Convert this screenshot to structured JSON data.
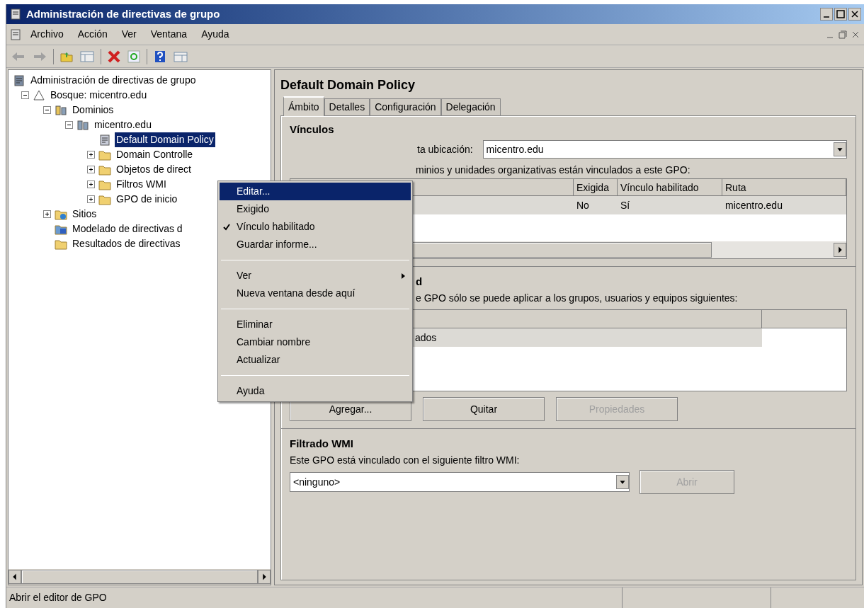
{
  "window": {
    "title": "Administración de directivas de grupo"
  },
  "menu_bar": [
    "Archivo",
    "Acción",
    "Ver",
    "Ventana",
    "Ayuda"
  ],
  "tree": [
    {
      "label": "Administración de directivas de grupo",
      "kind": "console",
      "selected": false,
      "children": [
        {
          "label": "Bosque: micentro.edu",
          "kind": "forest",
          "expanded": true,
          "selected": false,
          "children": [
            {
              "label": "Dominios",
              "kind": "domains",
              "expanded": true,
              "selected": false,
              "children": [
                {
                  "label": "micentro.edu",
                  "kind": "domain",
                  "expanded": true,
                  "selected": false,
                  "children": [
                    {
                      "label": "Default Domain Policy",
                      "kind": "gpo",
                      "selected": true
                    },
                    {
                      "label": "Domain Controlle",
                      "kind": "folder",
                      "expanded": false,
                      "selected": false
                    },
                    {
                      "label": "Objetos de direct",
                      "kind": "folder",
                      "expanded": false,
                      "selected": false
                    },
                    {
                      "label": "Filtros WMI",
                      "kind": "filter",
                      "expanded": false,
                      "selected": false
                    },
                    {
                      "label": "GPO de inicio",
                      "kind": "folder",
                      "expanded": false,
                      "selected": false
                    }
                  ]
                }
              ]
            },
            {
              "label": "Sitios",
              "kind": "sites",
              "expanded": false,
              "selected": false
            },
            {
              "label": "Modelado de directivas d",
              "kind": "modeling",
              "selected": false
            },
            {
              "label": "Resultados de directivas",
              "kind": "results",
              "selected": false
            }
          ]
        }
      ]
    }
  ],
  "details": {
    "title": "Default Domain Policy",
    "tabs": [
      {
        "label": "Ámbito",
        "selected": true
      },
      {
        "label": "Detalles",
        "selected": false
      },
      {
        "label": "Configuración",
        "selected": false
      },
      {
        "label": "Delegación",
        "selected": false
      }
    ],
    "links": {
      "title": "Vínculos",
      "location_label": "ta ubicación:",
      "location_value": "micentro.edu",
      "description": "minios y unidades organizativas están vinculados a este GPO:",
      "columns": [
        "Exigida",
        "Vínculo habilitado",
        "Ruta"
      ],
      "rows": [
        {
          "cells": [
            "No",
            "Sí",
            "micentro.edu"
          ],
          "selected": true
        }
      ]
    },
    "security": {
      "title": "d",
      "description": "e GPO sólo se puede aplicar a los grupos, usuarios y equipos siguientes:",
      "rows": [
        {
          "cell": "ados",
          "selected": true
        }
      ],
      "buttons": [
        {
          "label": "Agregar...",
          "disabled": false
        },
        {
          "label": "Quitar",
          "disabled": false
        },
        {
          "label": "Propiedades",
          "disabled": true
        }
      ]
    },
    "wmi": {
      "title": "Filtrado WMI",
      "description": "Este GPO está vinculado con el siguiente filtro WMI:",
      "value": "<ninguno>",
      "button": {
        "label": "Abrir",
        "disabled": true
      }
    }
  },
  "context_menu": [
    {
      "kind": "item",
      "label": "Editar...",
      "selected": true,
      "checked": false,
      "submenu": false
    },
    {
      "kind": "item",
      "label": "Exigido",
      "selected": false,
      "checked": false,
      "submenu": false
    },
    {
      "kind": "item",
      "label": "Vínculo habilitado",
      "selected": false,
      "checked": true,
      "submenu": false
    },
    {
      "kind": "item",
      "label": "Guardar informe...",
      "selected": false,
      "checked": false,
      "submenu": false
    },
    {
      "kind": "separator"
    },
    {
      "kind": "item",
      "label": "Ver",
      "selected": false,
      "checked": false,
      "submenu": true
    },
    {
      "kind": "item",
      "label": "Nueva ventana desde aquí",
      "selected": false,
      "checked": false,
      "submenu": false
    },
    {
      "kind": "separator"
    },
    {
      "kind": "item",
      "label": "Eliminar",
      "selected": false,
      "checked": false,
      "submenu": false
    },
    {
      "kind": "item",
      "label": "Cambiar nombre",
      "selected": false,
      "checked": false,
      "submenu": false
    },
    {
      "kind": "item",
      "label": "Actualizar",
      "selected": false,
      "checked": false,
      "submenu": false
    },
    {
      "kind": "separator"
    },
    {
      "kind": "item",
      "label": "Ayuda",
      "selected": false,
      "checked": false,
      "submenu": false
    }
  ],
  "status_bar": {
    "text": "Abrir el editor de GPO"
  }
}
